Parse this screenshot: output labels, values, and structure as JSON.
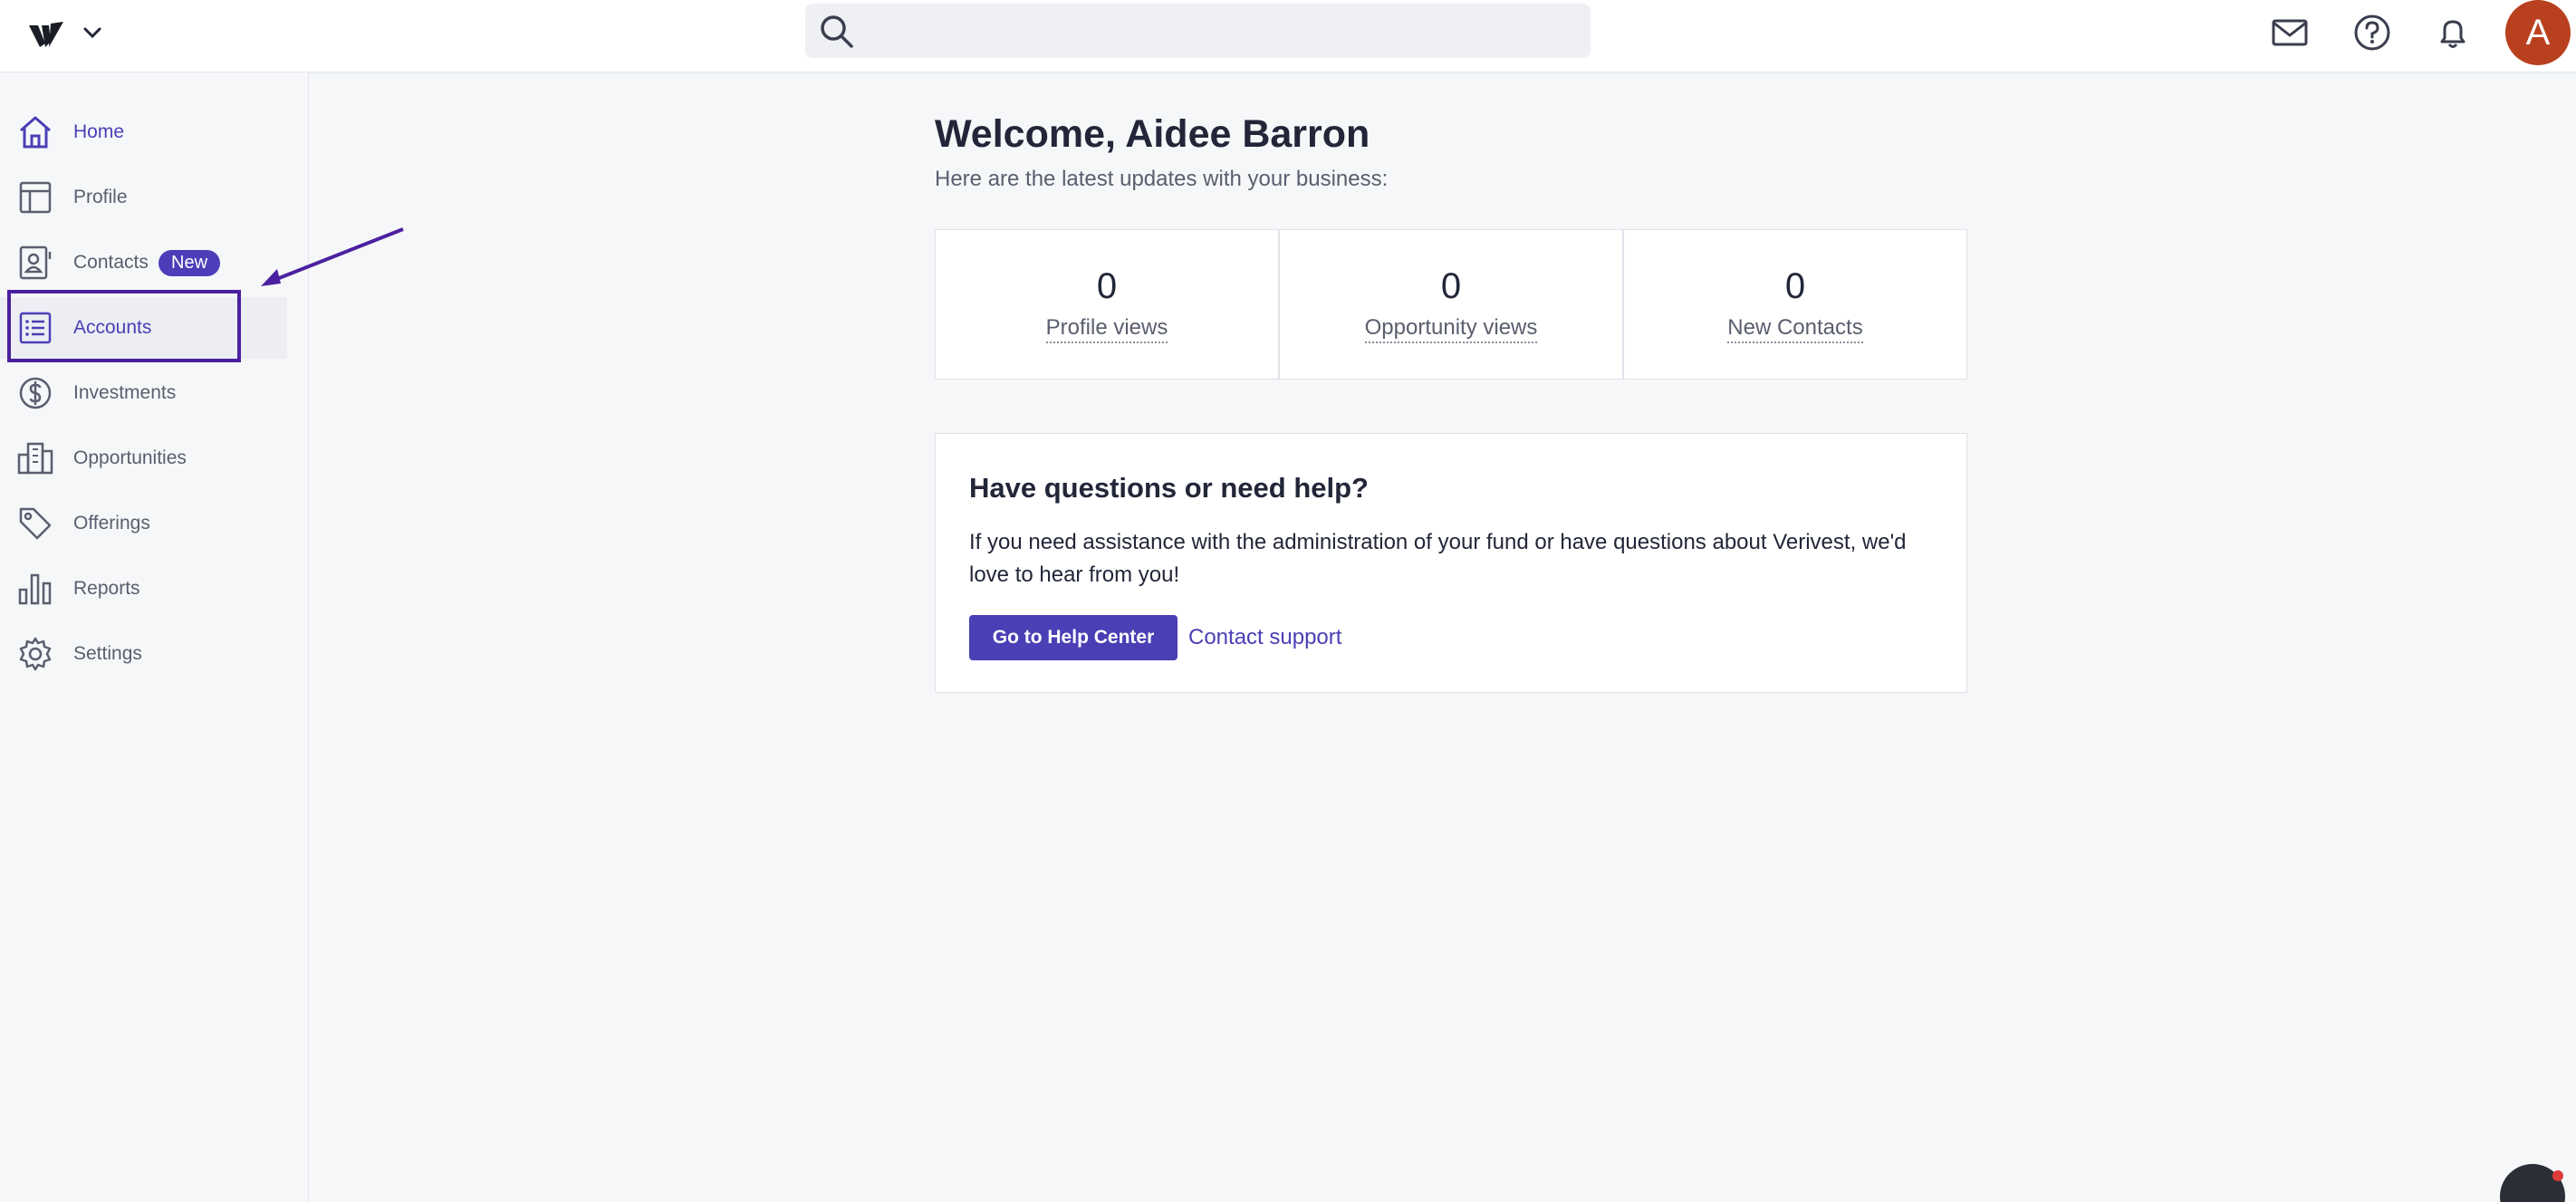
{
  "header": {
    "search_placeholder": "",
    "avatar_letter": "A"
  },
  "sidebar": {
    "items": [
      {
        "label": "Home"
      },
      {
        "label": "Profile"
      },
      {
        "label": "Contacts",
        "badge": "New"
      },
      {
        "label": "Accounts"
      },
      {
        "label": "Investments"
      },
      {
        "label": "Opportunities"
      },
      {
        "label": "Offerings"
      },
      {
        "label": "Reports"
      },
      {
        "label": "Settings"
      }
    ]
  },
  "main": {
    "welcome": "Welcome, Aidee Barron",
    "subtitle": "Here are the latest updates with your business:",
    "stats": [
      {
        "value": "0",
        "label": "Profile views"
      },
      {
        "value": "0",
        "label": "Opportunity views"
      },
      {
        "value": "0",
        "label": "New Contacts"
      }
    ],
    "help": {
      "title": "Have questions or need help?",
      "body": "If you need assistance with the administration of your fund or have questions about Verivest, we'd love to hear from you!",
      "button": "Go to Help Center",
      "link": "Contact support"
    }
  },
  "colors": {
    "accent": "#4a3fb5",
    "avatar": "#b9401f",
    "annotation": "#4b20a0"
  }
}
